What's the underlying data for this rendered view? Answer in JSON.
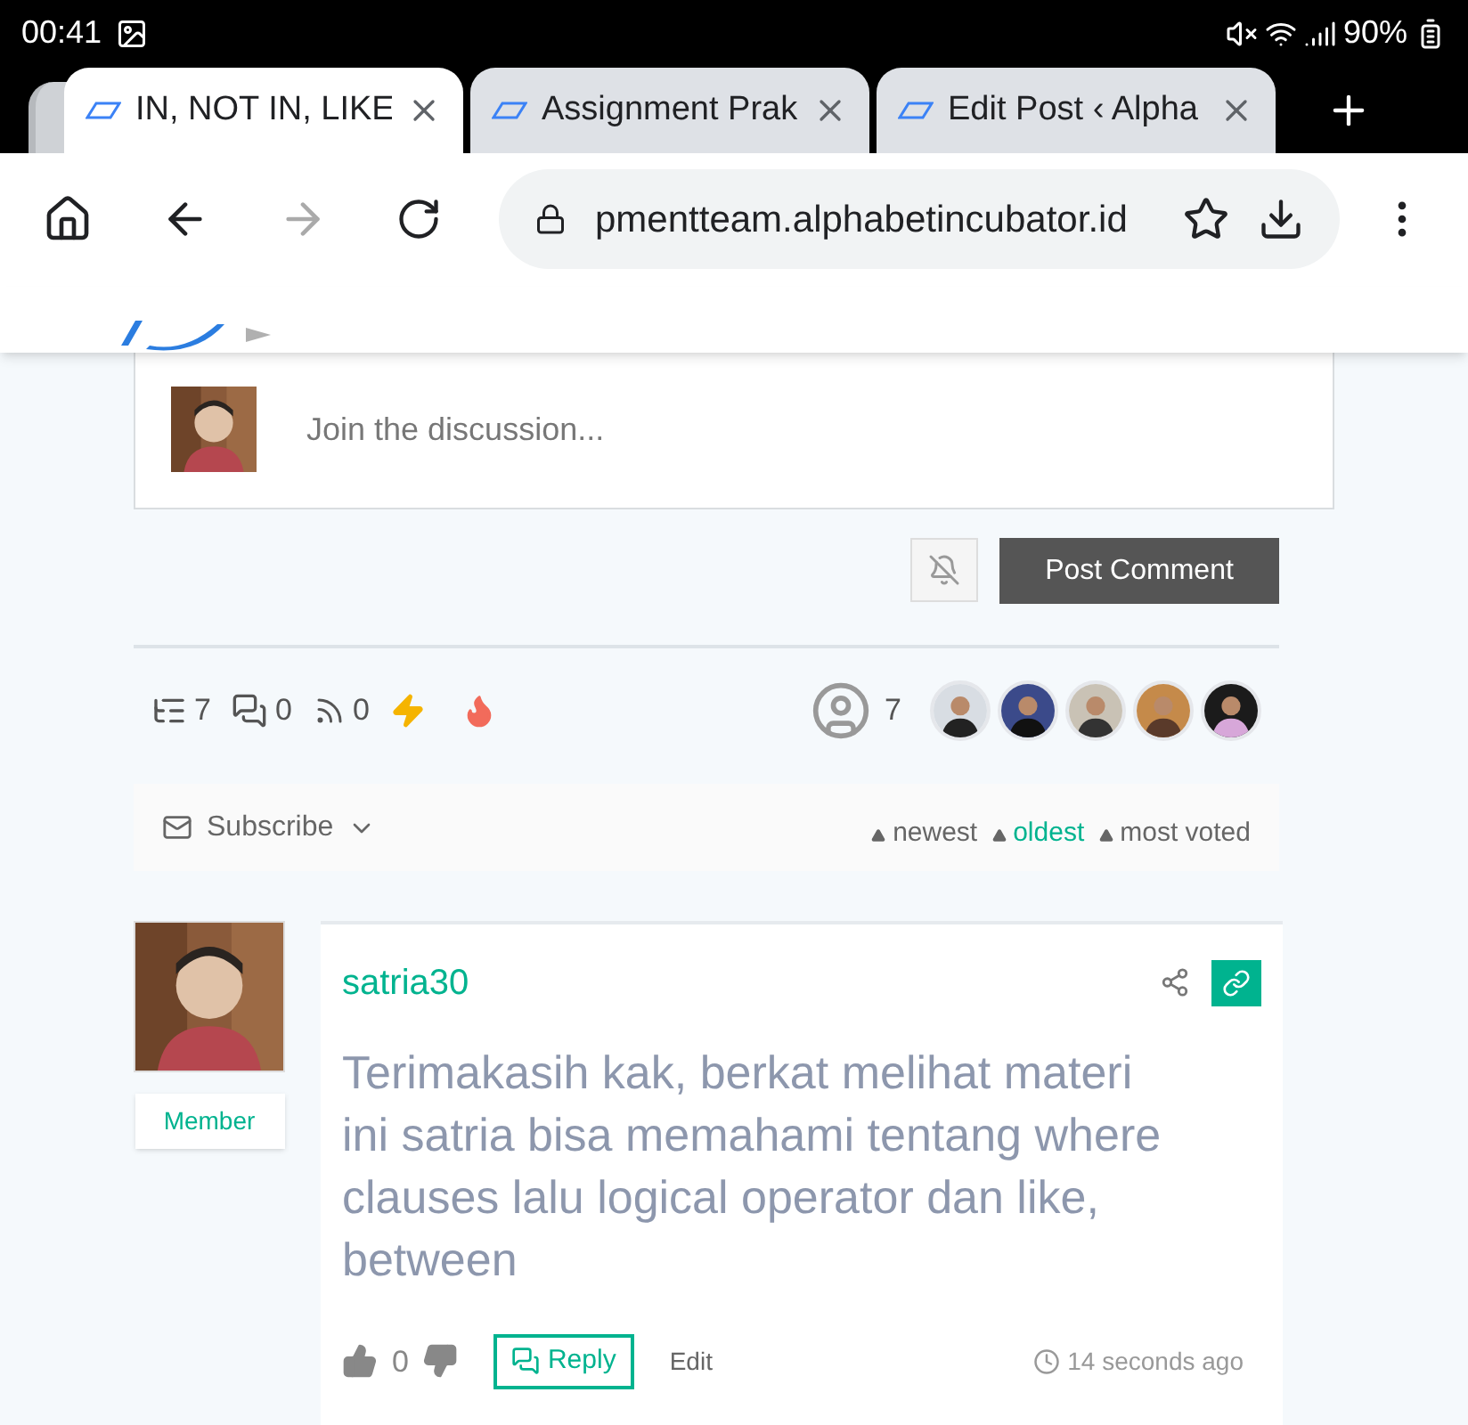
{
  "status_bar": {
    "time": "00:41",
    "battery": "90%"
  },
  "tabs": [
    {
      "title": "IN, NOT IN, LIKE",
      "selected": true
    },
    {
      "title": "Assignment Prak",
      "selected": false
    },
    {
      "title": "Edit Post ‹ Alpha",
      "selected": false
    }
  ],
  "toolbar": {
    "url": "pmentteam.alphabetincubator.id"
  },
  "comment_form": {
    "placeholder": "Join the discussion...",
    "notify": false,
    "submit": "Post Comment"
  },
  "stats": {
    "threads": "7",
    "replies": "0",
    "followers": "0",
    "participants": "7"
  },
  "subscribe": {
    "label": "Subscribe"
  },
  "sort": [
    {
      "label": "newest",
      "selected": false
    },
    {
      "label": "oldest",
      "selected": true
    },
    {
      "label": "most voted",
      "selected": false
    }
  ],
  "comment": {
    "author": "satria30",
    "role": "Member",
    "text": "Terimakasih kak, berkat melihat materi ini satria bisa memahami tentang where clauses lalu logical operator dan like, between",
    "votes": "0",
    "reply": "Reply",
    "edit": "Edit",
    "time": "14 seconds ago"
  }
}
